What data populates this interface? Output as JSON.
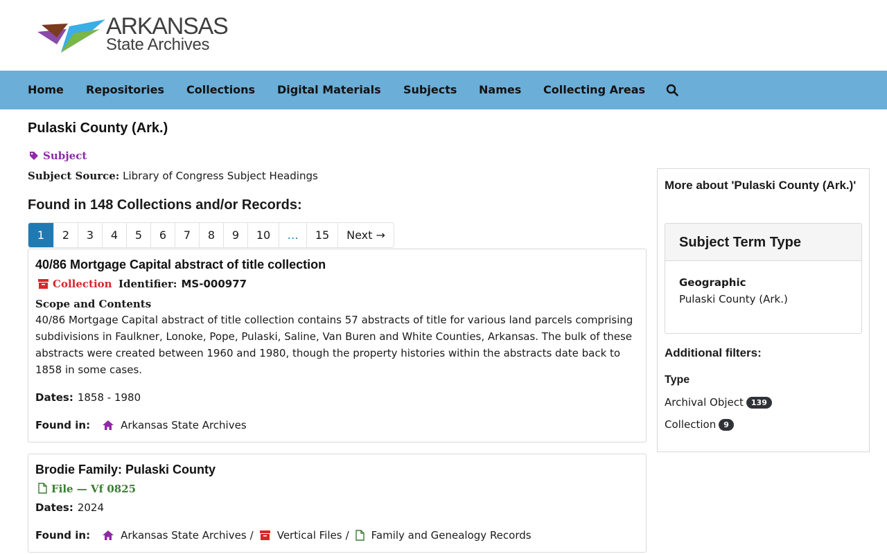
{
  "brand": {
    "line1": "ARKANSAS",
    "line2": "State Archives"
  },
  "nav": {
    "items": [
      {
        "label": "Home"
      },
      {
        "label": "Repositories"
      },
      {
        "label": "Collections"
      },
      {
        "label": "Digital Materials"
      },
      {
        "label": "Subjects"
      },
      {
        "label": "Names"
      },
      {
        "label": "Collecting Areas"
      }
    ]
  },
  "page": {
    "title": "Pulaski County (Ark.)",
    "badge": "Subject",
    "source_label": "Subject Source:",
    "source_value": "Library of Congress Subject Headings",
    "found_heading": "Found in 148 Collections and/or Records:"
  },
  "pagination": {
    "pages": [
      "1",
      "2",
      "3",
      "4",
      "5",
      "6",
      "7",
      "8",
      "9",
      "10",
      "…",
      "15"
    ],
    "next": "Next →",
    "active": "1"
  },
  "records": [
    {
      "title": "40/86 Mortgage Capital abstract of title collection",
      "type": "Collection",
      "identifier_label": "Identifier:",
      "identifier": "MS-000977",
      "scope_label": "Scope and Contents",
      "scope": "40/86 Mortgage Capital abstract of title collection contains 57 abstracts of title for various land parcels comprising subdivisions in Faulkner, Lonoke, Pope, Pulaski, Saline, Van Buren and White Counties, Arkansas. The bulk of these abstracts were created between 1960 and 1980, though the property histories within the abstracts date back to 1858 in some cases.",
      "dates_label": "Dates:",
      "dates": "1858 - 1980",
      "found_in_label": "Found in:",
      "found_in": [
        "Arkansas State Archives"
      ]
    },
    {
      "title": "Brodie Family: Pulaski County",
      "type": "File — Vf 0825",
      "dates_label": "Dates:",
      "dates": "2024",
      "found_in_label": "Found in:",
      "found_in": [
        "Arkansas State Archives",
        "Vertical Files",
        "Family and Genealogy Records"
      ],
      "separator": "/"
    }
  ],
  "sidebar": {
    "title": "More about 'Pulaski County (Ark.)'",
    "term_heading": "Subject Term Type",
    "term_type": "Geographic",
    "term_value": "Pulaski County (Ark.)",
    "additional_filters": "Additional filters:",
    "type_label": "Type",
    "filters": [
      {
        "label": "Archival Object",
        "count": "139"
      },
      {
        "label": "Collection",
        "count": "9"
      }
    ]
  },
  "colors": {
    "nav_bg": "#6baed8",
    "subject_purple": "#8e2aa3",
    "collection_red": "#d62728",
    "file_green": "#3a7d32",
    "active_page": "#1f7ab4"
  },
  "icons": [
    "search-icon",
    "tag-icon",
    "archive-box-icon",
    "file-icon",
    "home-icon"
  ]
}
